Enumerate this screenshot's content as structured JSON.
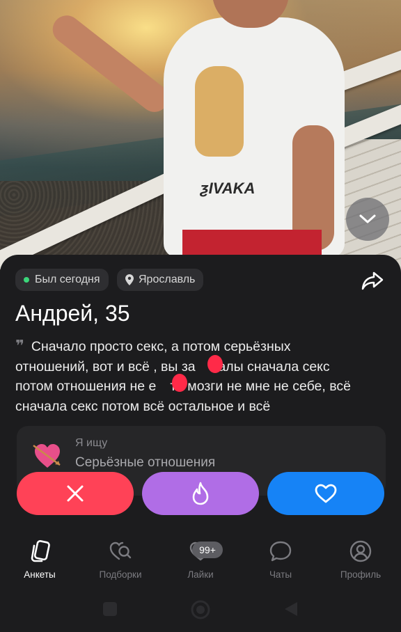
{
  "profile": {
    "status": "Был сегодня",
    "city": "Ярославль",
    "name_age": "Андрей, 35",
    "bio_line1": "Сначало просто секс, а потом серьёзных",
    "bio_line2": "отношений, вот и всё , вы за",
    "bio_line2b": "балы сначала секс",
    "bio_line3": "потом отношения не е",
    "bio_line3b": "те мозги не мне не себе, всё",
    "bio_line4": "сначала секс потом всё остальное и всё",
    "looking_label": "Я ищу",
    "looking_value": "Серьёзные отношения",
    "shirt_text": "ƺIVAKA"
  },
  "nav": {
    "items": [
      {
        "label": "Анкеты",
        "icon": "cards-icon"
      },
      {
        "label": "Подборки",
        "icon": "heart-search-icon"
      },
      {
        "label": "Лайки",
        "icon": "heart-icon"
      },
      {
        "label": "Чаты",
        "icon": "chat-icon"
      },
      {
        "label": "Профиль",
        "icon": "user-circle-icon"
      }
    ],
    "likes_badge": "99+"
  },
  "colors": {
    "dislike": "#ff4257",
    "superlike": "#b06de6",
    "like": "#1683f6",
    "online": "#3bd67a",
    "redaction": "#ff2a48"
  }
}
